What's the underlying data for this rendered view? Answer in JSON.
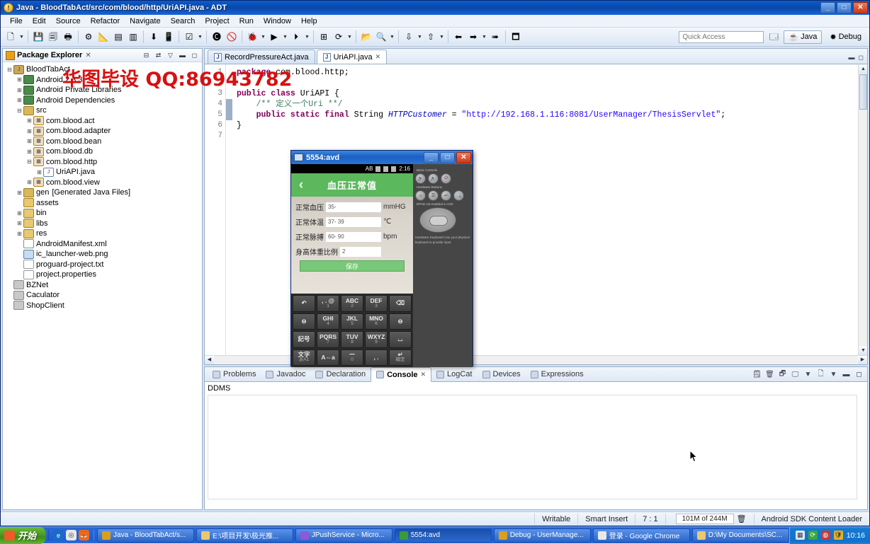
{
  "window": {
    "title": "Java - BloodTabAct/src/com/blood/http/UriAPI.java - ADT",
    "icon": "eclipse-icon",
    "minimize": "_",
    "maximize": "□",
    "close": "✕"
  },
  "menubar": [
    "File",
    "Edit",
    "Source",
    "Refactor",
    "Navigate",
    "Search",
    "Project",
    "Run",
    "Window",
    "Help"
  ],
  "toolbar": {
    "quick_access_placeholder": "Quick Access",
    "perspectives": [
      {
        "label": "Java",
        "icon": "java-perspective-icon",
        "active": true
      },
      {
        "label": "Debug",
        "icon": "debug-perspective-icon",
        "active": false
      }
    ],
    "open_perspective": "open-perspective-icon"
  },
  "package_explorer": {
    "title": "Package Explorer",
    "close_label": "✕",
    "tools": [
      "collapse-all-icon",
      "link-with-editor-icon",
      "view-menu-icon",
      "minimize-icon",
      "maximize-icon"
    ],
    "tree": [
      {
        "indent": 0,
        "exp": "-",
        "icon": "java-project-icon",
        "label": "BloodTabAct"
      },
      {
        "indent": 1,
        "exp": "+",
        "icon": "library-icon",
        "label": "Android 2.3.3"
      },
      {
        "indent": 1,
        "exp": "+",
        "icon": "library-icon",
        "label": "Android Private Libraries"
      },
      {
        "indent": 1,
        "exp": "+",
        "icon": "library-icon",
        "label": "Android Dependencies"
      },
      {
        "indent": 1,
        "exp": "-",
        "icon": "source-folder-icon",
        "label": "src"
      },
      {
        "indent": 2,
        "exp": "+",
        "icon": "package-icon",
        "label": "com.blood.act"
      },
      {
        "indent": 2,
        "exp": "+",
        "icon": "package-icon",
        "label": "com.blood.adapter"
      },
      {
        "indent": 2,
        "exp": "+",
        "icon": "package-icon",
        "label": "com.blood.bean"
      },
      {
        "indent": 2,
        "exp": "+",
        "icon": "package-icon",
        "label": "com.blood.db"
      },
      {
        "indent": 2,
        "exp": "-",
        "icon": "package-icon",
        "label": "com.blood.http"
      },
      {
        "indent": 3,
        "exp": "+",
        "icon": "java-file-icon",
        "label": "UriAPI.java"
      },
      {
        "indent": 2,
        "exp": "+",
        "icon": "package-icon",
        "label": "com.blood.view"
      },
      {
        "indent": 1,
        "exp": "+",
        "icon": "gen-folder-icon",
        "label": "gen",
        "suffix": "[Generated Java Files]"
      },
      {
        "indent": 1,
        "exp": "",
        "icon": "folder-icon",
        "label": "assets"
      },
      {
        "indent": 1,
        "exp": "+",
        "icon": "folder-icon",
        "label": "bin"
      },
      {
        "indent": 1,
        "exp": "+",
        "icon": "folder-icon",
        "label": "libs"
      },
      {
        "indent": 1,
        "exp": "+",
        "icon": "folder-icon",
        "label": "res"
      },
      {
        "indent": 1,
        "exp": "",
        "icon": "xml-file-icon",
        "label": "AndroidManifest.xml"
      },
      {
        "indent": 1,
        "exp": "",
        "icon": "image-file-icon",
        "label": "ic_launcher-web.png"
      },
      {
        "indent": 1,
        "exp": "",
        "icon": "text-file-icon",
        "label": "proguard-project.txt"
      },
      {
        "indent": 1,
        "exp": "",
        "icon": "text-file-icon",
        "label": "project.properties"
      },
      {
        "indent": 0,
        "exp": "",
        "icon": "closed-project-icon",
        "label": "BZNet"
      },
      {
        "indent": 0,
        "exp": "",
        "icon": "closed-project-icon",
        "label": "Caculator"
      },
      {
        "indent": 0,
        "exp": "",
        "icon": "closed-project-icon",
        "label": "ShopClient"
      }
    ]
  },
  "editor": {
    "tabs": [
      {
        "label": "RecordPressureAct.java",
        "active": false,
        "icon": "java-file-icon"
      },
      {
        "label": "UriAPI.java",
        "active": true,
        "icon": "java-file-icon",
        "close": "✕"
      }
    ],
    "line_numbers": [
      "1",
      "2",
      "3",
      "4",
      "5",
      "6",
      "7"
    ],
    "lines": [
      [
        {
          "t": "package ",
          "c": "kw"
        },
        {
          "t": "com.blood.http;",
          "c": ""
        }
      ],
      [],
      [
        {
          "t": "public class ",
          "c": "kw"
        },
        {
          "t": "UriAPI {",
          "c": ""
        }
      ],
      [
        {
          "t": "    /** 定义一个Uri **/",
          "c": "cmt"
        }
      ],
      [
        {
          "t": "    public static final ",
          "c": "kw"
        },
        {
          "t": "String ",
          "c": ""
        },
        {
          "t": "HTTPCustomer",
          "c": "fld"
        },
        {
          "t": " = ",
          "c": ""
        },
        {
          "t": "\"http://192.168.1.116:8081/UserManager/ThesisServlet\"",
          "c": "str"
        },
        {
          "t": ";",
          "c": ""
        }
      ],
      [
        {
          "t": "}",
          "c": ""
        }
      ],
      []
    ]
  },
  "console": {
    "tabs": [
      {
        "label": "Problems",
        "icon": "problems-icon",
        "active": false
      },
      {
        "label": "Javadoc",
        "icon": "javadoc-icon",
        "active": false
      },
      {
        "label": "Declaration",
        "icon": "declaration-icon",
        "active": false
      },
      {
        "label": "Console",
        "icon": "console-icon",
        "active": true,
        "close": "✕"
      },
      {
        "label": "LogCat",
        "icon": "logcat-icon",
        "active": false
      },
      {
        "label": "Devices",
        "icon": "devices-icon",
        "active": false
      },
      {
        "label": "Expressions",
        "icon": "expressions-icon",
        "active": false
      }
    ],
    "tools": [
      "terminate-icon",
      "remove-launch-icon",
      "new-console-view-icon",
      "display-console-icon",
      "open-console-icon",
      "minimize-icon",
      "maximize-icon"
    ],
    "content_label": "DDMS"
  },
  "statusbar": {
    "writable": "Writable",
    "insert_mode": "Smart Insert",
    "position": "7 : 1",
    "memory": "101M of 244M",
    "trash_icon": "trash-icon",
    "job": "Android SDK Content Loader"
  },
  "emulator": {
    "title": "5554:avd",
    "minimize": "_",
    "maximize": "□",
    "close": "✕",
    "android_status": {
      "ime": "AB",
      "time": "2:16",
      "icons": [
        "lock-icon",
        "signal-icon",
        "battery-icon"
      ]
    },
    "appbar": {
      "back_icon": "back-chevron-icon",
      "title": "血压正常值"
    },
    "fields": [
      {
        "label": "正常血压",
        "value": "35-",
        "unit": "mmHG"
      },
      {
        "label": "正常体温",
        "value": "37- 39",
        "unit": "℃"
      },
      {
        "label": "正常脉搏",
        "value": "60- 90",
        "unit": "bpm"
      },
      {
        "label": "身高体重比例",
        "value": "2",
        "unit": ""
      }
    ],
    "save_button": "保存",
    "keyboard": [
      {
        "k1": "↶",
        "k2": ""
      },
      {
        "k1": ", . @",
        "k2": "1"
      },
      {
        "k1": "ABC",
        "k2": "2"
      },
      {
        "k1": "DEF",
        "k2": "3"
      },
      {
        "k1": "⌫",
        "k2": ""
      },
      {
        "k1": "⊖",
        "k2": ""
      },
      {
        "k1": "GHI",
        "k2": "4"
      },
      {
        "k1": "JKL",
        "k2": "5"
      },
      {
        "k1": "MNO",
        "k2": "6"
      },
      {
        "k1": "⊖",
        "k2": ""
      },
      {
        "k1": "記号",
        "k2": ""
      },
      {
        "k1": "PQRS",
        "k2": "7"
      },
      {
        "k1": "TUV",
        "k2": "8"
      },
      {
        "k1": "WXYZ",
        "k2": "9"
      },
      {
        "k1": "⌴",
        "k2": ""
      },
      {
        "k1": "文字",
        "k2": "あA1"
      },
      {
        "k1": "A⇔a",
        "k2": ""
      },
      {
        "k1": "ー",
        "k2": "0"
      },
      {
        "k1": ", .",
        "k2": ""
      },
      {
        "k1": "↵",
        "k2": "確定"
      }
    ],
    "controls": {
      "basic_title": "Basic Controls",
      "hardware_title": "Hardware Buttons",
      "dpad_title": "DPAD not enabled in AVD",
      "note": "Hardware Keyboard\nUse your physical keyboard to provide input"
    }
  },
  "watermark": "华图毕设  QQ:86943782",
  "taskbar": {
    "start_label": "开始",
    "quick_launch": [
      "ie-icon",
      "chrome-icon",
      "firefox-icon"
    ],
    "tasks": [
      {
        "label": "Java - BloodTabAct/s...",
        "icon": "eclipse-icon",
        "active": false
      },
      {
        "label": "E:\\项目开发\\极光推...",
        "icon": "folder-icon",
        "active": false
      },
      {
        "label": "JPushService - Micro...",
        "icon": "vs-icon",
        "active": false
      },
      {
        "label": "5554:avd",
        "icon": "emulator-icon",
        "active": true
      },
      {
        "label": "Debug - UserManage...",
        "icon": "eclipse-icon",
        "active": false
      },
      {
        "label": "登录 - Google Chrome",
        "icon": "chrome-icon",
        "active": false
      },
      {
        "label": "D:\\My Documents\\SC...",
        "icon": "folder-icon",
        "active": false
      }
    ],
    "tray_icons": [
      "calendar-icon",
      "sync-icon",
      "network-icon",
      "shield-icon"
    ],
    "clock": "10:16"
  }
}
